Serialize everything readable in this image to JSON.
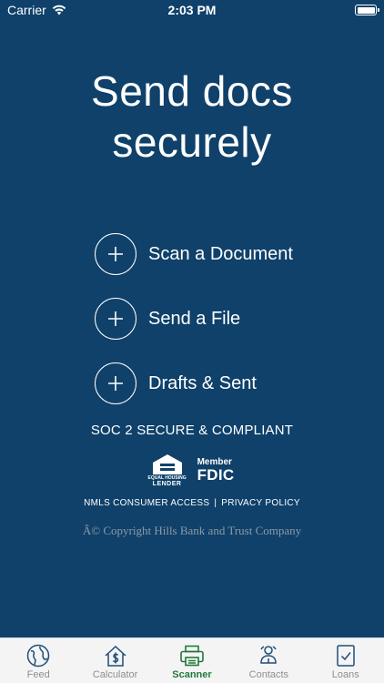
{
  "status_bar": {
    "carrier": "Carrier",
    "time": "2:03 PM"
  },
  "headline": {
    "line1": "Send docs",
    "line2": "securely"
  },
  "actions": [
    {
      "label": "Scan a Document"
    },
    {
      "label": "Send a File"
    },
    {
      "label": "Drafts & Sent"
    }
  ],
  "compliance": "SOC 2 SECURE & COMPLIANT",
  "ehl_logo": {
    "line1": "EQUAL HOUSING",
    "line2": "LENDER"
  },
  "fdic_logo": {
    "member": "Member",
    "name": "FDIC"
  },
  "links": {
    "nmls": "NMLS CONSUMER ACCESS",
    "separator": "|",
    "privacy": "PRIVACY POLICY"
  },
  "copyright": "Â© Copyright Hills Bank and Trust Company",
  "tab_bar": {
    "active_tab": "Scanner",
    "active_color": "#217a3b",
    "inactive_color": "#8e8e93",
    "tabs": [
      {
        "label": "Feed",
        "icon": "globe-icon"
      },
      {
        "label": "Calculator",
        "icon": "house-dollar-icon"
      },
      {
        "label": "Scanner",
        "icon": "scanner-icon"
      },
      {
        "label": "Contacts",
        "icon": "contacts-icon"
      },
      {
        "label": "Loans",
        "icon": "document-check-icon"
      }
    ]
  },
  "colors": {
    "background": "#0f416a",
    "text": "#ffffff",
    "copyright": "#8e9aa6"
  }
}
